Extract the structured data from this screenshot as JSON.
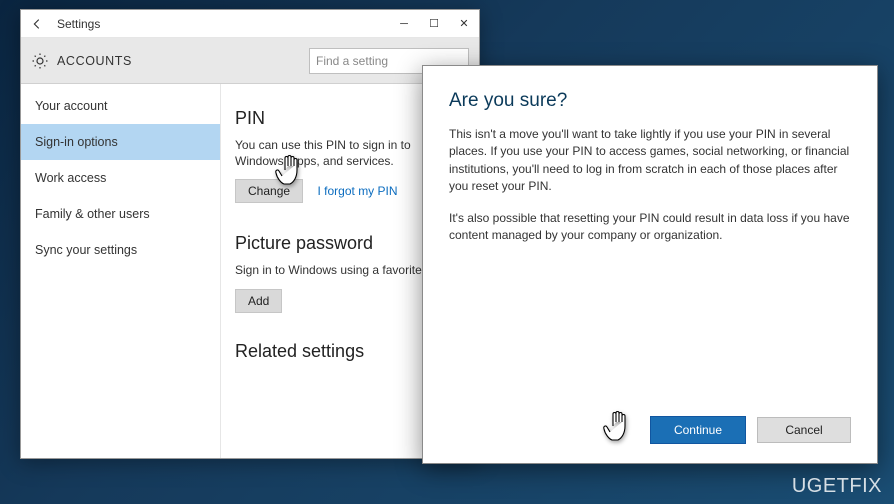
{
  "window": {
    "title": "Settings",
    "header_label": "ACCOUNTS",
    "search_placeholder": "Find a setting"
  },
  "sidebar": {
    "items": [
      {
        "label": "Your account"
      },
      {
        "label": "Sign-in options"
      },
      {
        "label": "Work access"
      },
      {
        "label": "Family & other users"
      },
      {
        "label": "Sync your settings"
      }
    ]
  },
  "content": {
    "pin_title": "PIN",
    "pin_sub": "You can use this PIN to sign in to Windows, apps, and services.",
    "change_label": "Change",
    "forgot_link": "I forgot my PIN",
    "picpass_title": "Picture password",
    "picpass_sub": "Sign in to Windows using a favorite photo.",
    "add_label": "Add",
    "related_title": "Related settings"
  },
  "dialog": {
    "title": "Are you sure?",
    "para1": "This isn't a move you'll want to take lightly if you use your PIN in several places. If you use your PIN to access games, social networking, or financial institutions, you'll need to log in from scratch in each of those places after you reset your PIN.",
    "para2": "It's also possible that resetting your PIN could result in data loss if you have content managed by your company or organization.",
    "continue_label": "Continue",
    "cancel_label": "Cancel"
  },
  "watermark": "UGETFIX"
}
